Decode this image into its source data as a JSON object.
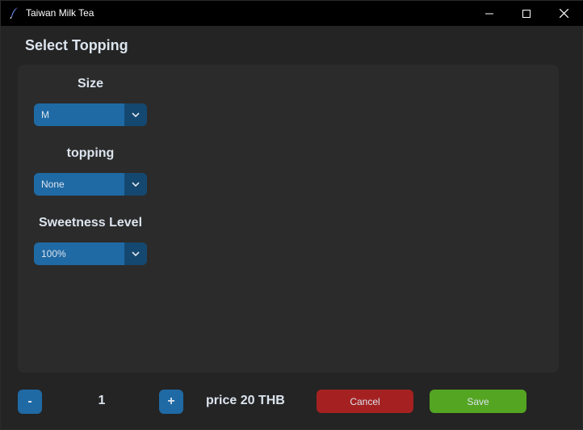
{
  "window": {
    "title": "Taiwan Milk Tea",
    "app_icon": "feather-icon",
    "controls": [
      "minimize-icon",
      "maximize-icon",
      "close-icon"
    ]
  },
  "header": {
    "title": "Select Topping"
  },
  "form": {
    "size": {
      "label": "Size",
      "value": "M"
    },
    "topping": {
      "label": "topping",
      "value": "None"
    },
    "sweetness": {
      "label": "Sweetness Level",
      "value": "100%"
    }
  },
  "footer": {
    "minus_label": "-",
    "quantity": "1",
    "plus_label": "+",
    "price_text": "price 20 THB",
    "cancel_label": "Cancel",
    "save_label": "Save"
  },
  "colors": {
    "background": "#242424",
    "panel": "#2b2b2b",
    "accent": "#1f6aa5",
    "accent_dark": "#144870",
    "cancel": "#a52121",
    "save": "#54a521",
    "text": "#dce4ee"
  }
}
